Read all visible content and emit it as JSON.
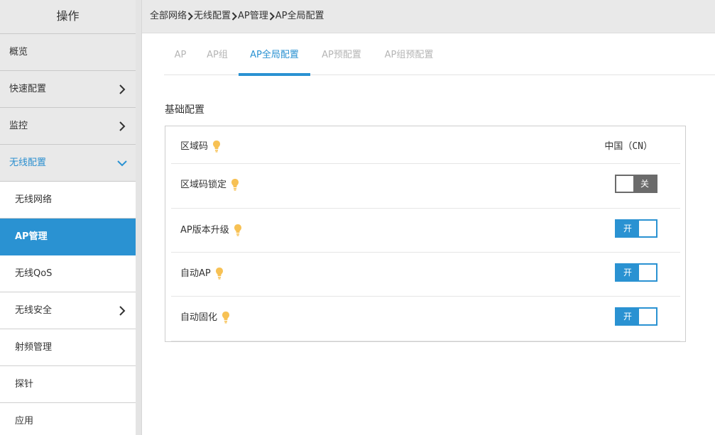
{
  "sidebar": {
    "header": "操作",
    "items": [
      {
        "label": "概览",
        "has_chevron": false
      },
      {
        "label": "快速配置",
        "has_chevron": true,
        "chevron": "right"
      },
      {
        "label": "监控",
        "has_chevron": true,
        "chevron": "right"
      },
      {
        "label": "无线配置",
        "has_chevron": true,
        "chevron": "down",
        "expanded": true
      }
    ],
    "subitems": [
      {
        "label": "无线网络",
        "selected": false
      },
      {
        "label": "AP管理",
        "selected": true
      },
      {
        "label": "无线QoS",
        "selected": false
      },
      {
        "label": "无线安全",
        "selected": false,
        "has_chevron": true
      },
      {
        "label": "射频管理",
        "selected": false
      },
      {
        "label": "探针",
        "selected": false
      },
      {
        "label": "应用",
        "selected": false
      }
    ]
  },
  "breadcrumb": [
    "全部网络",
    "无线配置",
    "AP管理",
    "AP全局配置"
  ],
  "tabs": [
    {
      "label": "AP",
      "active": false
    },
    {
      "label": "AP组",
      "active": false
    },
    {
      "label": "AP全局配置",
      "active": true
    },
    {
      "label": "AP预配置",
      "active": false
    },
    {
      "label": "AP组预配置",
      "active": false
    }
  ],
  "section": {
    "title": "基础配置",
    "rows": [
      {
        "label": "区域码",
        "value": "中国（CN）",
        "type": "text"
      },
      {
        "label": "区域码锁定",
        "type": "toggle",
        "state": "off",
        "toggle_text": "关"
      },
      {
        "label": "AP版本升级",
        "type": "toggle",
        "state": "on",
        "toggle_text": "开"
      },
      {
        "label": "自动AP",
        "type": "toggle",
        "state": "on",
        "toggle_text": "开"
      },
      {
        "label": "自动固化",
        "type": "toggle",
        "state": "on",
        "toggle_text": "开"
      }
    ]
  },
  "colors": {
    "accent": "#2a92d2",
    "sidebar_bg": "#e9e9e9",
    "toggle_off": "#6b6b6b",
    "hint_bulb": "#f7c154",
    "tab_inactive": "#b5b5b5"
  },
  "icons": {
    "chevron_right": "chevron-right-icon",
    "chevron_down": "chevron-down-icon",
    "hint": "lightbulb-icon",
    "breadcrumb_separator": "breadcrumb-chevron-icon"
  }
}
